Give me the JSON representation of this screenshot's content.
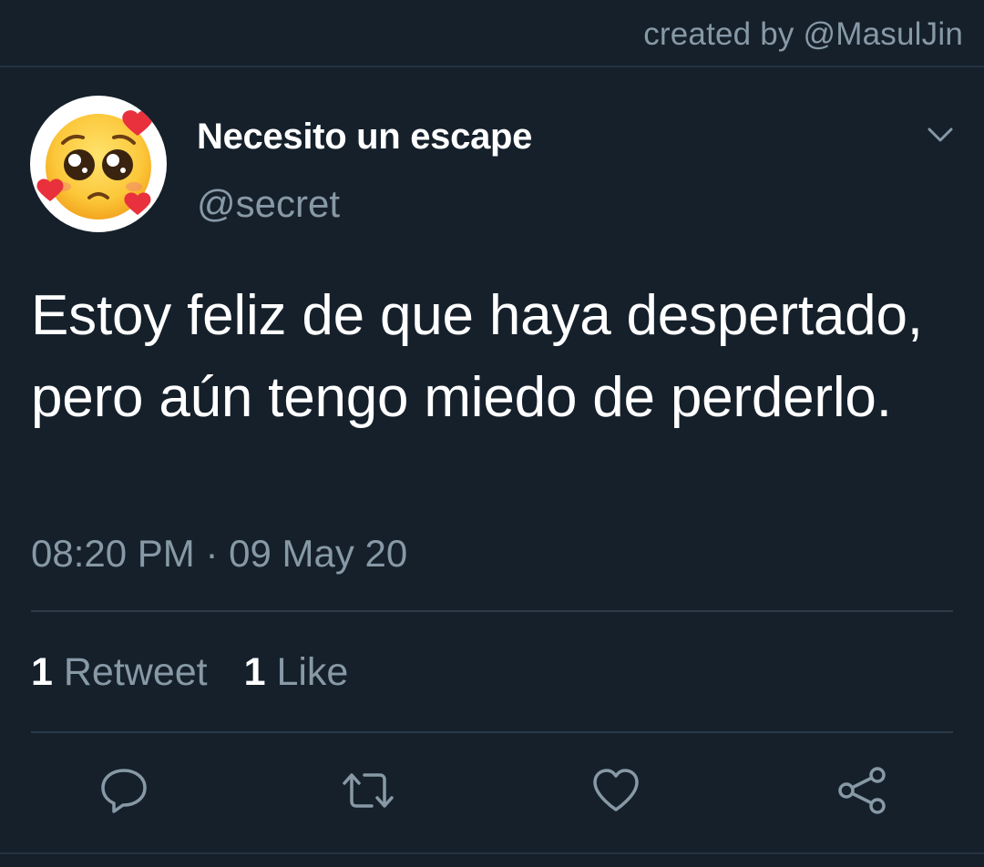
{
  "credit": "created by @MasulJin",
  "tweet": {
    "display_name": "Necesito un escape",
    "handle": "@secret",
    "text": "Estoy feliz de que haya despertado, pero aún tengo miedo de perderlo.",
    "timestamp": "08:20 PM · 09 May 20"
  },
  "stats": {
    "retweets_count": "1",
    "retweets_label": "Retweet",
    "likes_count": "1",
    "likes_label": "Like"
  },
  "icons": {
    "avatar": "pleading-face-with-hearts-emoji",
    "caret": "chevron-down-icon",
    "reply": "reply-bubble-icon",
    "retweet": "retweet-icon",
    "like": "heart-icon",
    "share": "share-icon"
  },
  "colors": {
    "background": "#15202b",
    "text_primary": "#ffffff",
    "text_secondary": "#8899a6",
    "divider": "#2c3a48"
  }
}
